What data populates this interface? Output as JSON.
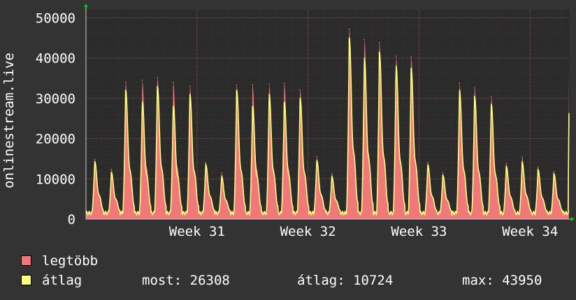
{
  "chart_data": {
    "type": "area",
    "ylabel": "onlinestream.live",
    "ylim": [
      0,
      52000
    ],
    "yticks": [
      "0",
      "10000",
      "20000",
      "30000",
      "40000",
      "50000"
    ],
    "ytick_values": [
      0,
      10000,
      20000,
      30000,
      40000,
      50000
    ],
    "xticks": [
      "Week 31",
      "Week 32",
      "Week 33",
      "Week 34"
    ],
    "xtick_days": [
      7,
      14,
      21,
      28
    ],
    "x_range_days": [
      0,
      30.5
    ],
    "grid": true,
    "colors": {
      "background": "#333333",
      "plot": "#2b2b2b",
      "grid": "#5a3f3f",
      "axis": "#cccccc",
      "max_fill": "#f07878",
      "avg_line": "#ffff80"
    },
    "daily_peaks": {
      "days": [
        0.55,
        1.6,
        2.5,
        3.55,
        4.5,
        5.5,
        6.55,
        7.55,
        8.55,
        9.5,
        10.5,
        11.55,
        12.5,
        13.5,
        14.55,
        15.5,
        16.6,
        17.55,
        18.5,
        19.55,
        20.5,
        21.55,
        22.5,
        23.55,
        24.5,
        25.55,
        26.5,
        27.5,
        28.5,
        29.5
      ],
      "max_values": [
        14800,
        12300,
        34000,
        34500,
        35200,
        34000,
        33000,
        14000,
        11500,
        33300,
        33400,
        33500,
        33700,
        32100,
        15500,
        11300,
        47200,
        44600,
        43800,
        40500,
        40300,
        14100,
        11500,
        33700,
        32600,
        30400,
        13800,
        15400,
        13000,
        11800
      ],
      "avg_values": [
        14300,
        11500,
        32000,
        29000,
        33000,
        28000,
        31000,
        13500,
        10500,
        32000,
        28000,
        31000,
        29000,
        30000,
        14500,
        10500,
        45000,
        40000,
        41500,
        38000,
        37500,
        13500,
        10800,
        32000,
        30500,
        28500,
        13000,
        14000,
        12200,
        11200
      ]
    },
    "last_point": {
      "day": 30.45,
      "max": 37400,
      "avg": 26308
    },
    "series": [
      {
        "name": "legtöbb",
        "color": "#f07878"
      },
      {
        "name": "átlag",
        "color": "#ffff80"
      }
    ],
    "stats": {
      "current": "most: 26308",
      "average": "átlag: 10724",
      "max": "max: 43950"
    }
  }
}
